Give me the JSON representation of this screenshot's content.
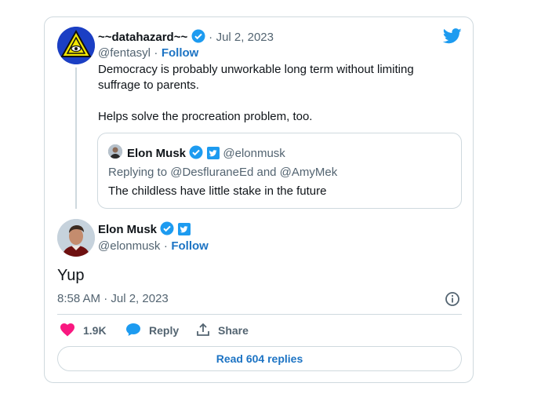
{
  "quoted_tweet": {
    "display_name": "~~datahazard~~",
    "date": "Jul 2, 2023",
    "handle": "@fentasyl",
    "follow_label": "Follow",
    "text_line1": "Democracy is probably unworkable long term without limiting",
    "text_line2": "suffrage to parents.",
    "text_line3": "Helps solve the procreation problem, too.",
    "embedded": {
      "display_name": "Elon Musk",
      "handle": "@elonmusk",
      "replying_to": "Replying to @DesfluraneEd and @AmyMek",
      "text": "The childless have little stake in the future"
    }
  },
  "main_tweet": {
    "display_name": "Elon Musk",
    "handle": "@elonmusk",
    "follow_label": "Follow",
    "text": "Yup",
    "timestamp": "8:58 AM · Jul 2, 2023"
  },
  "actions": {
    "likes": "1.9K",
    "reply_label": "Reply",
    "share_label": "Share",
    "read_replies_label": "Read 604 replies"
  },
  "separators": {
    "dot": "·"
  },
  "colors": {
    "accent": "#1d9bf0",
    "like": "#f91880",
    "border": "#cfd9de",
    "muted": "#536471"
  }
}
